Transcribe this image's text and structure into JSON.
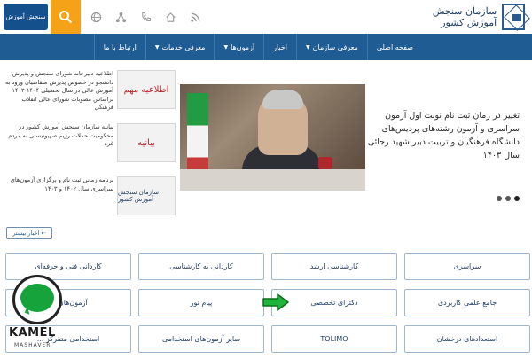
{
  "header": {
    "logo_text": "سازمان سنجش آموزش کشور",
    "emblem_text": "سنجش آموزش"
  },
  "nav": {
    "items": [
      {
        "label": "صفحه اصلی",
        "has_dropdown": false
      },
      {
        "label": "معرفی سازمان",
        "has_dropdown": true
      },
      {
        "label": "اخبار",
        "has_dropdown": false
      },
      {
        "label": "آزمون‌ها",
        "has_dropdown": true
      },
      {
        "label": "معرفی خدمات",
        "has_dropdown": true
      },
      {
        "label": "ارتباط با ما",
        "has_dropdown": false
      }
    ]
  },
  "slider": {
    "caption": "تغییر در زمان ثبت نام نوبت اول آزمون سراسری و آزمون رشته‌های پردیس‌های دانشگاه فرهنگیان و تربیت دبیر شهید رجائی سال ۱۴۰۳"
  },
  "side_news": [
    {
      "thumb": "اطلاعیه مهم",
      "text": "اطلاعیه دبیرخانه شورای سنجش و پذیرش دانشجو در خصوص پذیرش متقاضیان ورود به آموزش عالی در سال تحصیلی ۱۴۰۴-۱۴۰۳ براساس مصوبات شورای عالی انقلاب فرهنگی"
    },
    {
      "thumb": "بیانیه",
      "text": "بیانیه سازمان سنجش آموزش کشور در محکومیت حملات رژیم صهیونیستی به مردم غزه"
    },
    {
      "thumb": "سازمان سنجش آموزش کشور",
      "text": "برنامه زمانی ثبت نام و برگزاری آزمون‌های سراسری سال ۱۴۰۲ و ۱۴۰۳"
    }
  ],
  "more_news_label": "اخبار بیشتر",
  "grid": {
    "cells": [
      "سراسری",
      "کارشناسی ارشد",
      "کاردانی به کارشناسی",
      "کاردانی فنی و حرفه‌ای",
      "جامع علمی کاربردی",
      "دکترای تخصصی",
      "پیام نور",
      "آزمون‌های ...",
      "استعدادهای درخشان",
      "TOLIMO",
      "سایر آزمون‌های استخدامی",
      "استخدامی متمرکز ..."
    ]
  },
  "watermark": {
    "brand": "KAMEL",
    "sub": "MASHAVER"
  },
  "colors": {
    "nav": "#1e5c93",
    "accent": "#f5a218"
  }
}
